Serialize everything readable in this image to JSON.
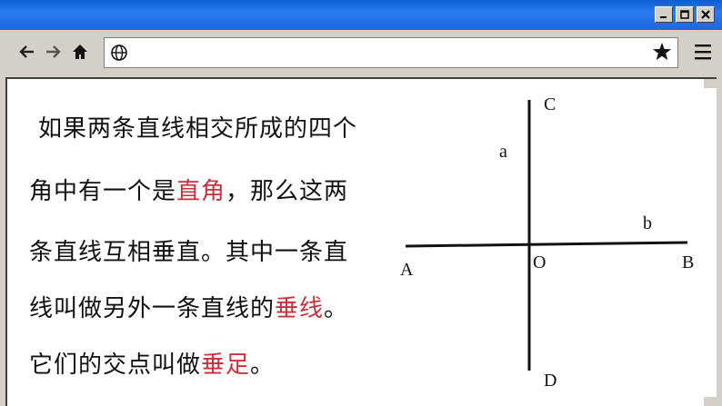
{
  "browser": {
    "window_controls": [
      "minimize",
      "maximize",
      "close"
    ],
    "nav_icons": [
      "back-arrow-icon",
      "forward-arrow-icon",
      "home-icon",
      "globe-icon",
      "star-icon",
      "hamburger-menu-icon"
    ],
    "url": ""
  },
  "slide": {
    "line1": "如果两条直线相交所成的四个",
    "line2_a": "角中有一个是",
    "line2_red": "直角",
    "line2_b": "，那么这两",
    "line3": "条直线互相垂直。其中一条直",
    "line4_a": "线叫做另外一条直线的",
    "line4_red": "垂线",
    "line4_b": "。",
    "line5_a": "它们的交点叫做",
    "line5_red": "垂足",
    "line5_b": "。",
    "highlight_color": "#c9303a"
  },
  "diagram": {
    "labels": {
      "C": "C",
      "D": "D",
      "A": "A",
      "B": "B",
      "O": "O",
      "line_a": "a",
      "line_b": "b"
    }
  }
}
